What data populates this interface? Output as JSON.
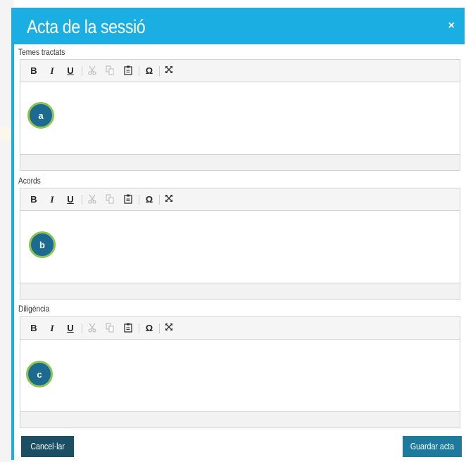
{
  "dialog": {
    "title": "Acta de la sessió",
    "close_symbol": "×"
  },
  "toolbar": {
    "bold": "B",
    "italic": "I",
    "underline": "U",
    "cut_icon": "scissors-icon",
    "copy_icon": "copy-icon",
    "paste_icon": "clipboard-icon",
    "special_char": "Ω",
    "maximize_icon": "expand-icon"
  },
  "fields": [
    {
      "label": "Temes tractats",
      "marker": "a"
    },
    {
      "label": "Acords",
      "marker": "b"
    },
    {
      "label": "Diligència",
      "marker": "c"
    }
  ],
  "footer": {
    "cancel_label": "Cancel·lar",
    "save_label": "Guardar acta"
  },
  "colors": {
    "header": "#1aaee2",
    "cancel_button": "#1c4f63",
    "save_button": "#1e7a9c",
    "marker_fill": "#1c6a8f",
    "marker_ring": "#8dc350"
  }
}
